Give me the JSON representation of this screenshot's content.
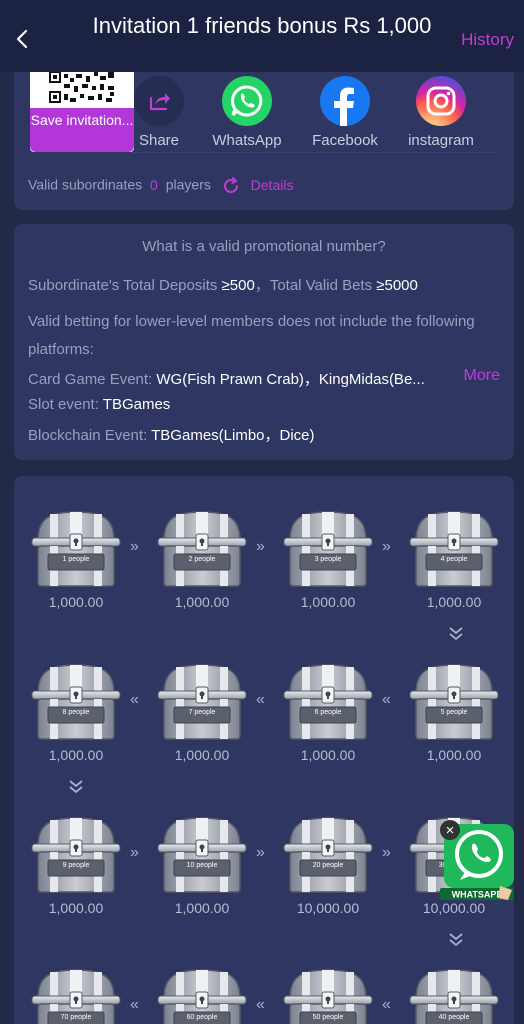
{
  "header": {
    "title": "Invitation 1 friends bonus Rs 1,000",
    "history": "History"
  },
  "share": {
    "save_label": "Save invitation...",
    "items": [
      {
        "label": "Share",
        "icon": "share-icon"
      },
      {
        "label": "WhatsApp",
        "icon": "whatsapp-icon"
      },
      {
        "label": "Facebook",
        "icon": "facebook-icon"
      },
      {
        "label": "instagram",
        "icon": "instagram-icon"
      }
    ],
    "subs_label": "Valid subordinates",
    "subs_count": "0",
    "subs_unit": "players",
    "details": "Details"
  },
  "rules": {
    "title": "What is a valid promotional number?",
    "deposits_label": "Subordinate's Total Deposits ",
    "deposits_value": "≥500",
    "bets_label": "，Total Valid Bets ",
    "bets_value": "≥5000",
    "para": "Valid betting for lower-level members does not include the following platforms:",
    "card_label": "Card Game Event: ",
    "card_value": "WG(Fish Prawn Crab)，KingMidas(Be...",
    "more": "More",
    "slot_label": "Slot event: ",
    "slot_value": "TBGames",
    "block_label": "Blockchain Event: ",
    "block_value": "TBGames(Limbo，Dice)"
  },
  "chests": [
    {
      "label": "1 people",
      "amount": "1,000.00"
    },
    {
      "label": "2 people",
      "amount": "1,000.00"
    },
    {
      "label": "3 people",
      "amount": "1,000.00"
    },
    {
      "label": "4 people",
      "amount": "1,000.00"
    },
    {
      "label": "8 people",
      "amount": "1,000.00"
    },
    {
      "label": "7 people",
      "amount": "1,000.00"
    },
    {
      "label": "6 people",
      "amount": "1,000.00"
    },
    {
      "label": "5 people",
      "amount": "1,000.00"
    },
    {
      "label": "9 people",
      "amount": "1,000.00"
    },
    {
      "label": "10 people",
      "amount": "1,000.00"
    },
    {
      "label": "20 people",
      "amount": "10,000.00"
    },
    {
      "label": "30 people",
      "amount": "10,000.00"
    },
    {
      "label": "70 people",
      "amount": ""
    },
    {
      "label": "60 people",
      "amount": ""
    },
    {
      "label": "50 people",
      "amount": ""
    },
    {
      "label": "40 people",
      "amount": ""
    }
  ],
  "floating": {
    "label": "WHATSAPP",
    "close": "×"
  },
  "colors": {
    "accent": "#c13cd8",
    "background": "#222a47",
    "card": "#2e3661"
  }
}
